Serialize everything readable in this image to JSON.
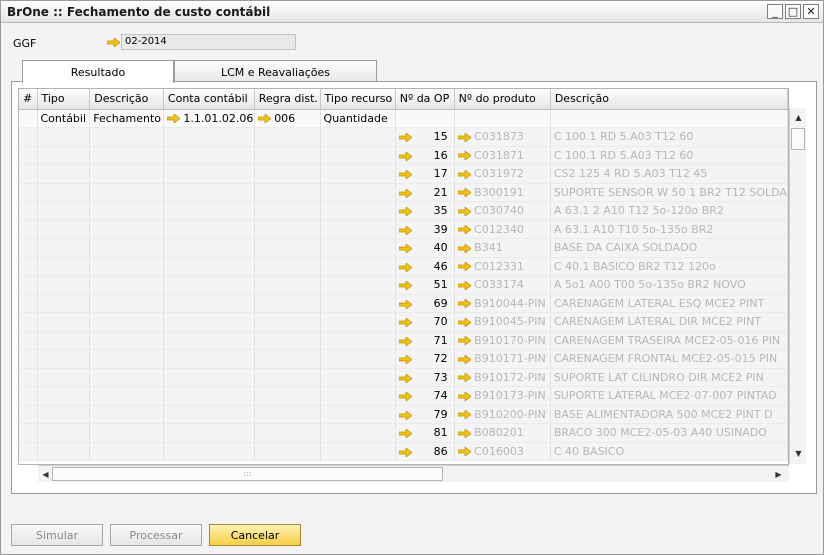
{
  "window": {
    "title": "BrOne :: Fechamento de custo contábil",
    "minimize": "_",
    "maximize": "□",
    "close": "✕"
  },
  "ggf": {
    "label": "GGF",
    "value": "02-2014"
  },
  "tabs": [
    {
      "label": "Resultado"
    },
    {
      "label": "LCM e Reavaliações"
    }
  ],
  "grid": {
    "columns": [
      "#",
      "Tipo",
      "Descrição",
      "Conta contábil",
      "Regra dist.",
      "Tipo recurso",
      "Nº da OP",
      "Nº do produto",
      "Descrição"
    ],
    "first_row": {
      "tipo": "Contábil",
      "descricao": "Fechamento",
      "conta": "1.1.01.02.06",
      "regra": "006",
      "recurso": "Quantidade"
    },
    "op_rows": [
      {
        "op": "15",
        "produto": "C031873",
        "descricao": "C 100.1 RD 5.A03 T12 60"
      },
      {
        "op": "16",
        "produto": "C031871",
        "descricao": "C 100.1 RD 5.A03 T12 60"
      },
      {
        "op": "17",
        "produto": "C031972",
        "descricao": "CS2 125 4 RD 5.A03 T12 45"
      },
      {
        "op": "21",
        "produto": "B300191",
        "descricao": "SUPORTE SENSOR W 50 1 BR2 T12 SOLDA"
      },
      {
        "op": "35",
        "produto": "C030740",
        "descricao": "A 63.1 2 A10 T12 5o-120o BR2"
      },
      {
        "op": "39",
        "produto": "C012340",
        "descricao": "A 63.1 A10 T10 5o-135o BR2"
      },
      {
        "op": "40",
        "produto": "B341",
        "descricao": "BASE DA CAIXA SOLDADO"
      },
      {
        "op": "46",
        "produto": "C012331",
        "descricao": "C 40.1 BASICO BR2 T12 120o"
      },
      {
        "op": "51",
        "produto": "C033174",
        "descricao": "A 5o1 A00 T00 5o-135o BR2 NOVO"
      },
      {
        "op": "69",
        "produto": "B910044-PIN",
        "descricao": "CARENAGEM LATERAL ESQ MCE2 PINT"
      },
      {
        "op": "70",
        "produto": "B910045-PIN",
        "descricao": "CARENAGEM LATERAL DIR MCE2 PINT"
      },
      {
        "op": "71",
        "produto": "B910170-PIN",
        "descricao": "CARENAGEM TRASEIRA MCE2-05-016 PIN"
      },
      {
        "op": "72",
        "produto": "B910171-PIN",
        "descricao": "CARENAGEM FRONTAL MCE2-05-015 PIN"
      },
      {
        "op": "73",
        "produto": "B910172-PIN",
        "descricao": "SUPORTE LAT CILINDRO DIR MCE2 PIN"
      },
      {
        "op": "74",
        "produto": "B910173-PIN",
        "descricao": "SUPORTE LATERAL MCE2-07-007 PINTAD"
      },
      {
        "op": "79",
        "produto": "B910200-PIN",
        "descricao": "BASE ALIMENTADORA 500 MCE2 PINT D"
      },
      {
        "op": "81",
        "produto": "B080201",
        "descricao": "BRACO 300 MCE2-05-03 A40 USINADO"
      },
      {
        "op": "86",
        "produto": "C016003",
        "descricao": "C 40 BASICO"
      }
    ]
  },
  "buttons": {
    "simular": "Simular",
    "processar": "Processar",
    "cancelar": "Cancelar"
  },
  "colors": {
    "arrow": "#f2c418",
    "primary_button": "#f6cf47"
  }
}
